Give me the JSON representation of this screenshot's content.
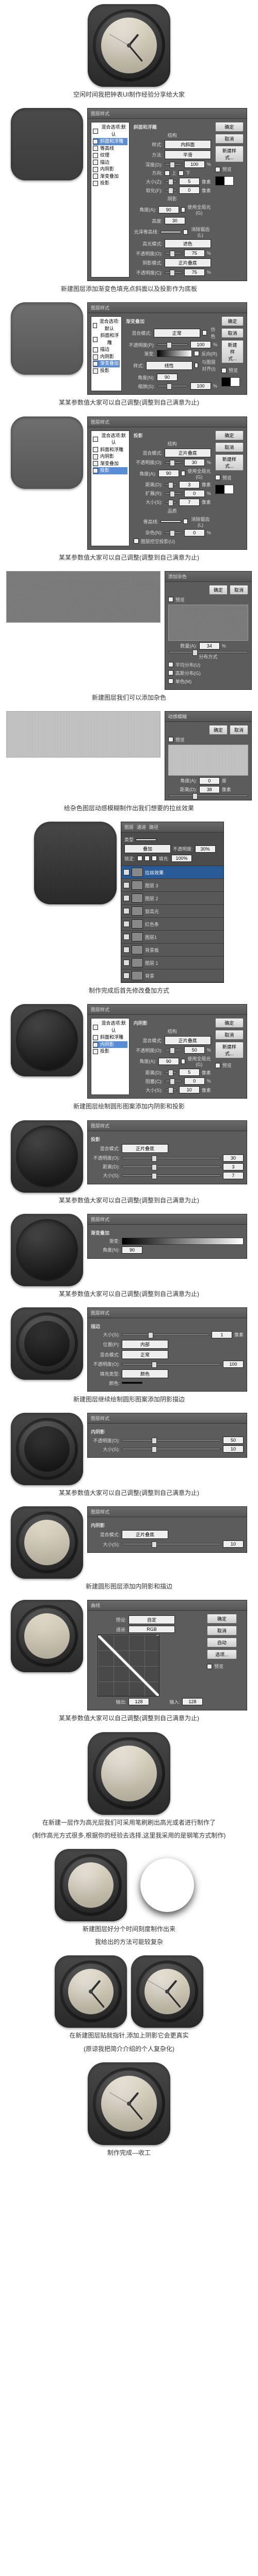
{
  "steps": {
    "s1": "空闲时间我把钟表UI制作经验分享给大家",
    "s2": "新建图层添加渐变色填充点斜面以及投影作为底板",
    "s3": "某某参数值大家可以自己调整(调整到自己满意为止)",
    "s4": "某某参数值大家可以自己调整(调整到自己满意为止)",
    "s5": "新建图层我们可以添加杂色",
    "s6": "给杂色图层动感模糊制作出我们想要的拉丝效果",
    "s7": "制作完成后首先修改叠加方式",
    "s8": "新建图层绘制圆形图案添加内阴影和投影",
    "s9": "某某参数值大家可以自己调整(调整到自己满意为止)",
    "s10": "某某参数值大家可以自己调整(调整到自己满意为止)",
    "s11": "新建图层继续绘制圆形图案添加阴影描边",
    "s12": "某某参数值大家可以自己调整(调整到自己满意为止)",
    "s13": "新建圆形图层添加内阴影和描边",
    "s14": "某某参数值大家可以自己调整(调整到自己满意为止)",
    "s15a": "在新建一层作为高光层我们可采用笔刷刷出高光或者进行制作了",
    "s15b": "(制作高光方式很多,根据你的经验去选择,这里我采用的是钢笔方式制作)",
    "s16a": "新建图层好分个时间刻度制作出来",
    "s16b": "我给出的方法可能较复杂",
    "s17": "在新建图层贴就指针,添加上阴影它会更真实",
    "s18": "(原谅我把简介介绍的个人复杂化)",
    "s19": "制作完成—收工"
  },
  "layerStyle": {
    "dialogTitle": "图层样式",
    "fx": [
      "混合选项:默认",
      "斜面和浮雕",
      "等高线",
      "纹理",
      "描边",
      "内阴影",
      "内发光",
      "光泽",
      "颜色叠加",
      "渐变叠加",
      "图案叠加",
      "外发光",
      "投影"
    ],
    "buttons": {
      "ok": "确定",
      "cancel": "取消",
      "newStyle": "新建样式...",
      "preview": "预览"
    },
    "bevel": {
      "section": "斜面和浮雕",
      "structure": "结构",
      "styleLbl": "样式:",
      "styleVal": "内斜面",
      "techLbl": "方法:",
      "techVal": "平滑",
      "depthLbl": "深度(D):",
      "depthVal": "100",
      "pct": "%",
      "dirLbl": "方向:",
      "up": "上",
      "down": "下",
      "sizeLbl": "大小(Z):",
      "sizeVal": "5",
      "px": "像素",
      "softLbl": "软化(F):",
      "softVal": "0",
      "shade": "阴影",
      "angleLbl": "角度(A):",
      "angleVal": "90",
      "globalLight": "使用全局光(G)",
      "altLbl": "高度:",
      "altVal": "30",
      "glossLbl": "光泽等高线:",
      "antiAlias": "消除锯齿(L)",
      "hiModeLbl": "高光模式:",
      "hiModeVal": "滤色",
      "hiOpLbl": "不透明度(O):",
      "hiOpVal": "75",
      "shModeLbl": "阴影模式:",
      "shModeVal": "正片叠底",
      "shOpLbl": "不透明度(C):",
      "shOpVal": "75",
      "reset": "设置为默认值"
    },
    "gradient": {
      "section": "渐变叠加",
      "gradLbl": "渐变:",
      "blendLbl": "混合模式:",
      "blendVal": "正常",
      "dither": "仿色",
      "opLbl": "不透明度(P):",
      "opVal": "100",
      "reverse": "反向(R)",
      "styleLbl": "样式:",
      "styleVal": "线性",
      "align": "与图层对齐(I)",
      "angleLbl": "角度(N):",
      "angleVal": "90",
      "scaleLbl": "缩放(S):",
      "scaleVal": "100"
    },
    "drop": {
      "section": "投影",
      "structure": "结构",
      "blendLbl": "混合模式:",
      "blendVal": "正片叠底",
      "opLbl": "不透明度(O):",
      "opVal": "30",
      "angleLbl": "角度(A):",
      "angleVal": "90",
      "globalLight": "使用全局光(G)",
      "distLbl": "距离(D):",
      "distVal": "3",
      "px": "像素",
      "spreadLbl": "扩展(R):",
      "spreadVal": "0",
      "pct": "%",
      "sizeLbl": "大小(S):",
      "sizeVal": "7",
      "quality": "品质",
      "contourLbl": "等高线:",
      "antiAlias": "消除锯齿(L)",
      "noiseLbl": "杂色(N):",
      "noiseVal": "0",
      "knockout": "图层挖空投影(U)"
    },
    "inner": {
      "section": "内阴影",
      "structure": "结构",
      "blendLbl": "混合模式:",
      "blendVal": "正片叠底",
      "opLbl": "不透明度(O):",
      "opVal": "50",
      "angleLbl": "角度(A):",
      "angleVal": "90",
      "globalLight": "使用全局光(G)",
      "distLbl": "距离(D):",
      "distVal": "5",
      "px": "像素",
      "chokeLbl": "阻塞(C):",
      "chokeVal": "0",
      "pct": "%",
      "sizeLbl": "大小(S):",
      "sizeVal": "10"
    },
    "stroke": {
      "section": "描边",
      "sizeLbl": "大小(S):",
      "sizeVal": "1",
      "px": "像素",
      "posLbl": "位置(P):",
      "posVal": "内部",
      "blendLbl": "混合模式:",
      "blendVal": "正常",
      "opLbl": "不透明度(O):",
      "opVal": "100",
      "fillLbl": "填充类型:",
      "fillVal": "颜色",
      "colorLbl": "颜色:"
    }
  },
  "addNoise": {
    "title": "添加杂色",
    "ok": "确定",
    "cancel": "取消",
    "preview": "预览",
    "amountLbl": "数量(A):",
    "amountVal": "34",
    "pct": "%",
    "distribution": "分布方式",
    "uniform": "平均分布(U)",
    "gaussian": "高斯分布(G)",
    "mono": "单色(M)"
  },
  "motionBlur": {
    "title": "动感模糊",
    "ok": "确定",
    "cancel": "取消",
    "preview": "预览",
    "angleLbl": "角度(A):",
    "angleVal": "0",
    "deg": "度",
    "distLbl": "距离(D):",
    "distVal": "38",
    "px": "像素"
  },
  "layersPanel": {
    "tabs": [
      "图层",
      "通道",
      "路径"
    ],
    "kind": "类型",
    "blendMode": "叠加",
    "opacityLbl": "不透明度:",
    "opacityVal": "30%",
    "lockLbl": "锁定:",
    "fillLbl": "填充:",
    "fillVal": "100%",
    "items": [
      "拉丝效果",
      "图层 3",
      "图层 2",
      "窗高光",
      "红色条",
      "图层1",
      "背景板",
      "图层 1",
      "背景"
    ]
  },
  "curves": {
    "title": "曲线",
    "preset": "预设:",
    "presetVal": "自定",
    "channel": "通道:",
    "channelVal": "RGB",
    "outLbl": "输出:",
    "outVal": "128",
    "inLbl": "输入:",
    "inVal": "128",
    "ok": "确定",
    "cancel": "取消",
    "auto": "自动",
    "options": "选项...",
    "preview": "预览"
  }
}
